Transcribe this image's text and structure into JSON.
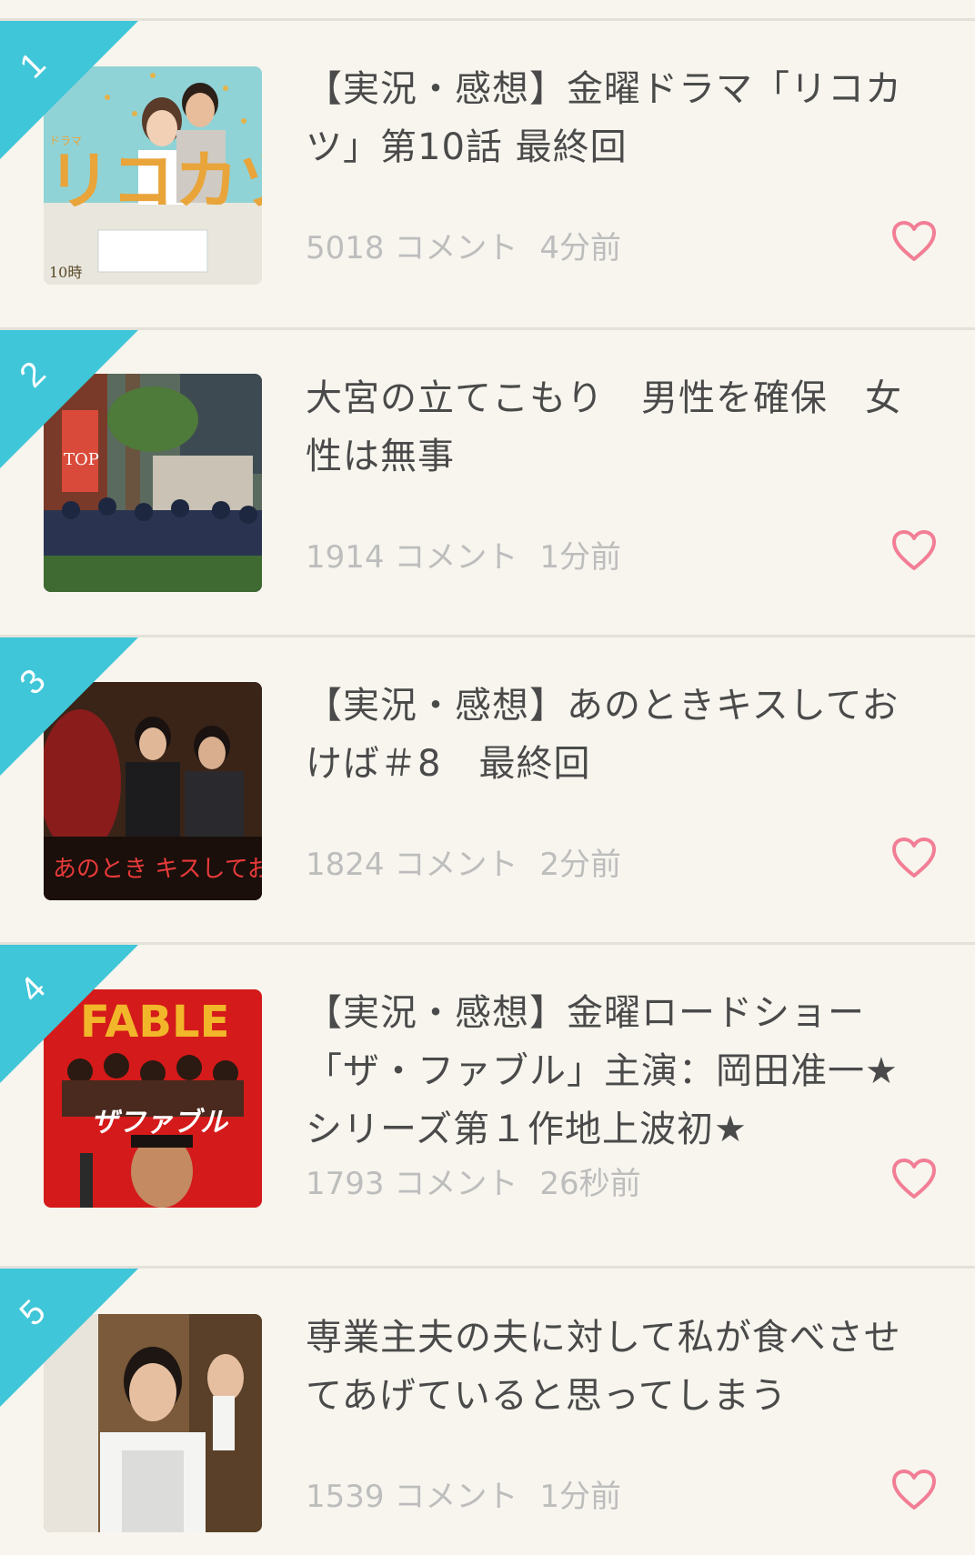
{
  "colors": {
    "background": "#f7f5ee",
    "divider": "#e3e1da",
    "rank_ribbon": "#3fc6d8",
    "title_text": "#4a4a4a",
    "meta_text": "#bdbdbd",
    "heart": "#f27e95"
  },
  "items": [
    {
      "rank": "1",
      "title": "【実況・感想】金曜ドラマ「リコカツ」第10話 最終回",
      "comments": "5018 コメント",
      "time": "4分前",
      "thumb_text": "リコカツ",
      "thumb_corner": "10時",
      "thumb_small": "ドラマ"
    },
    {
      "rank": "2",
      "title": "大宮の立てこもり　男性を確保　女性は無事",
      "comments": "1914 コメント",
      "time": "1分前",
      "thumb_sign": "TOP"
    },
    {
      "rank": "3",
      "title": "【実況・感想】あのときキスしておけば＃8　最終回",
      "comments": "1824 コメント",
      "time": "2分前",
      "thumb_text": "あのとき キスしておけば"
    },
    {
      "rank": "4",
      "title": "【実況・感想】金曜ロードショー「ザ・ファブル」主演：岡田准一★シリーズ第１作地上波初★",
      "comments": "1793 コメント",
      "time": "26秒前",
      "thumb_text": "ザファブル",
      "thumb_top": "FABLE"
    },
    {
      "rank": "5",
      "title": "専業主夫の夫に対して私が食べさせてあげていると思ってしまう",
      "comments": "1539 コメント",
      "time": "1分前"
    }
  ]
}
